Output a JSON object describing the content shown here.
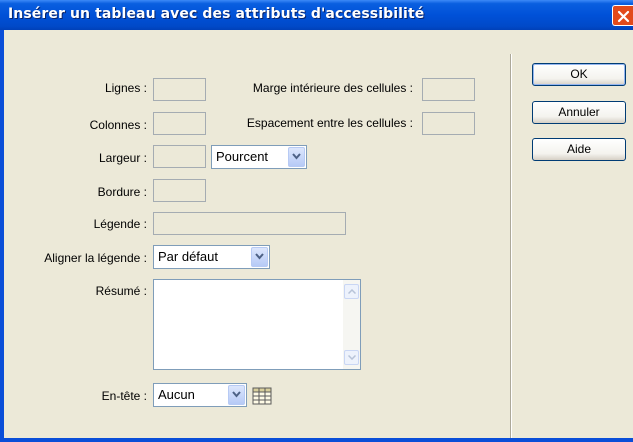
{
  "window": {
    "title": "Insérer un tableau avec des attributs d'accessibilité"
  },
  "form": {
    "rows_label": "Lignes :",
    "rows_value": "",
    "cellpadding_label": "Marge intérieure des cellules :",
    "cellpadding_value": "",
    "columns_label": "Colonnes :",
    "columns_value": "",
    "cellspacing_label": "Espacement entre les cellules :",
    "cellspacing_value": "",
    "width_label": "Largeur :",
    "width_value": "",
    "width_unit": "Pourcent",
    "border_label": "Bordure :",
    "border_value": "",
    "caption_label": "Légende :",
    "caption_value": "",
    "caption_align_label": "Aligner la légende :",
    "caption_align_value": "Par défaut",
    "summary_label": "Résumé :",
    "summary_value": "",
    "header_label": "En-tête :",
    "header_value": "Aucun"
  },
  "buttons": {
    "ok": "OK",
    "cancel": "Annuler",
    "help": "Aide"
  },
  "icons": {
    "close": "close-icon",
    "dropdown": "chevron-down-icon",
    "scroll_up": "arrow-up-icon",
    "scroll_down": "arrow-down-icon",
    "table": "table-icon"
  },
  "colors": {
    "titlebar": "#0054e3",
    "close_button": "#e24a1b",
    "dialog_background": "#ece9d8",
    "button_border": "#003c74"
  }
}
